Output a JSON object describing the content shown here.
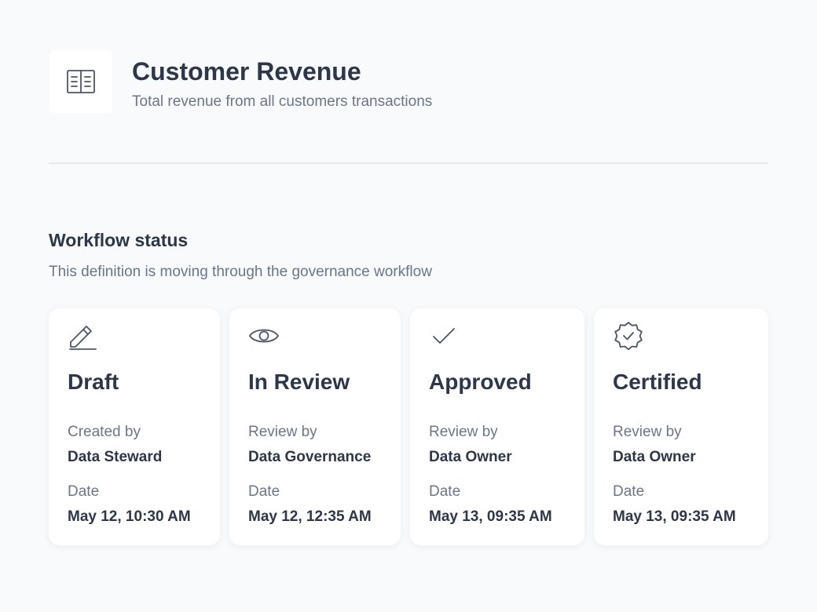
{
  "header": {
    "title": "Customer Revenue",
    "subtitle": "Total revenue from all customers transactions",
    "icon": "book-open-icon"
  },
  "workflow": {
    "title": "Workflow status",
    "description": "This definition is moving through the governance workflow",
    "steps": [
      {
        "status": "Draft",
        "icon": "pencil-icon",
        "by_label": "Created by",
        "by_value": "Data Steward",
        "date_label": "Date",
        "date_value": "May 12, 10:30 AM"
      },
      {
        "status": "In Review",
        "icon": "eye-icon",
        "by_label": "Review by",
        "by_value": "Data Governance",
        "date_label": "Date",
        "date_value": "May 12, 12:35 AM"
      },
      {
        "status": "Approved",
        "icon": "check-icon",
        "by_label": "Review by",
        "by_value": "Data Owner",
        "date_label": "Date",
        "date_value": "May 13, 09:35 AM"
      },
      {
        "status": "Certified",
        "icon": "certified-badge-icon",
        "by_label": "Review by",
        "by_value": "Data Owner",
        "date_label": "Date",
        "date_value": "May 13, 09:35 AM"
      }
    ]
  },
  "colors": {
    "background": "#f8fafc",
    "card": "#ffffff",
    "text_primary": "#2d3748",
    "text_secondary": "#6b7687",
    "divider": "#e5e9ee"
  }
}
